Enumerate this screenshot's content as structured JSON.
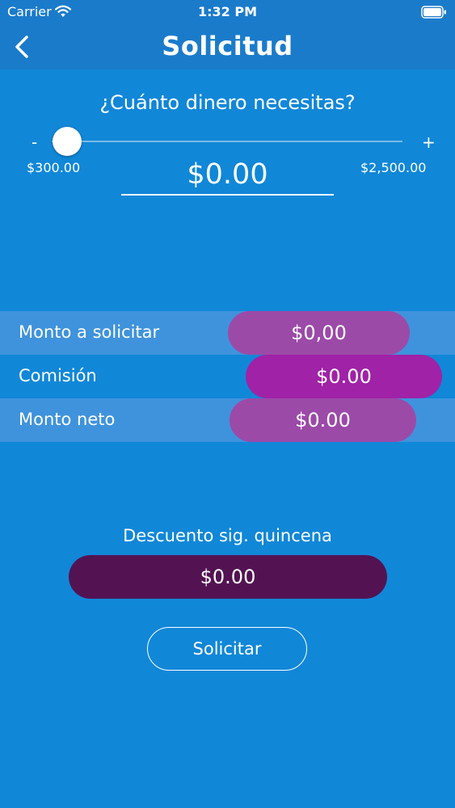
{
  "status_bar": {
    "carrier": "Carrier",
    "time": "1:32 PM",
    "wifi_icon": "wifi-icon",
    "battery_icon": "battery-icon"
  },
  "nav": {
    "title": "Solicitud",
    "back_icon": "chevron-left-icon"
  },
  "loan": {
    "question": "¿Cuánto dinero necesitas?",
    "minus_label": "-",
    "plus_label": "+",
    "min_label": "$300.00",
    "max_label": "$2,500.00",
    "amount": "$0.00",
    "slider_fraction": 0
  },
  "summary": {
    "rows": [
      {
        "label": "Monto a solicitar",
        "value": "$0,00"
      },
      {
        "label": "Comisión",
        "value": "$0.00"
      },
      {
        "label": "Monto neto",
        "value": "$0.00"
      }
    ]
  },
  "discount": {
    "label": "Descuento sig. quincena",
    "value": "$0.00"
  },
  "actions": {
    "submit_label": "Solicitar"
  },
  "colors": {
    "background": "#1187d8",
    "navbar": "#1a7bcb",
    "row_band_light": "#3f93dc",
    "pill_purple": "#9c4aa8",
    "pill_purple_bright": "#a022a6",
    "discount_pill": "#531352",
    "text": "#ffffff"
  }
}
